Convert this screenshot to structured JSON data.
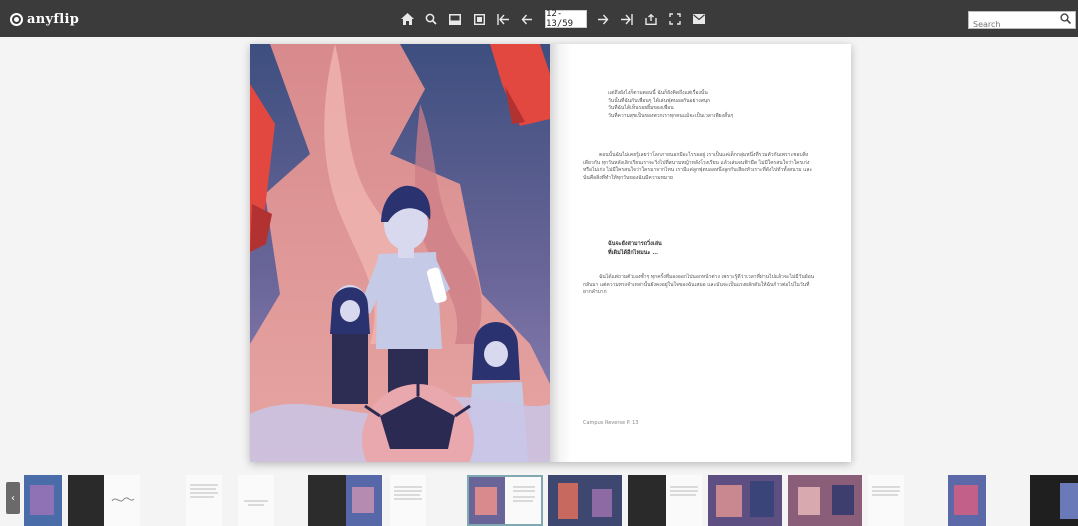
{
  "app": {
    "logo_text": "anyflip"
  },
  "toolbar": {
    "icons": [
      "home-icon",
      "zoom-icon",
      "thumbnails-icon",
      "single-page-icon",
      "first-page-icon",
      "prev-page-icon"
    ],
    "page_indicator": "12-13/59",
    "icons_after": [
      "next-page-icon",
      "last-page-icon",
      "share-icon",
      "fullscreen-icon",
      "email-icon"
    ]
  },
  "search": {
    "placeholder": "Search"
  },
  "page_right": {
    "block1": [
      "แต่ถึงยังไงก็ตามตอนนี้ ฉันก็ยังคิดถึงแต่เรื่องนั้น",
      "วันนั้นที่ฉันกับเพื่อนๆ ได้เล่นฟุตบอลกันอย่างสนุก",
      "วันที่ฉันได้เห็นรอยยิ้มของเพื่อน",
      "วันที่ความสุขเป็นของพวกเราทุกคนแม้จะเป็นเวลาเพียงสั้นๆ"
    ],
    "block2": "ตอนนั้นฉันไม่เคยรู้เลยว่าโลกภายนอกมีอะไรรออยู่ เราเป็นแค่เด็กกลุ่มหนึ่งที่รวมตัวกันเพราะชอบสิ่งเดียวกัน ทุกวันหลังเลิกเรียนเราจะวิ่งไปที่สนามหญ้าหลังโรงเรียน แล้วเล่นจนฟ้ามืด ไม่มีใครสนใจว่าใครเก่งหรือไม่เก่ง ไม่มีใครสนใจว่าใครมาจากไหน เรามีแค่ลูกฟุตบอลหนึ่งลูกกับเสียงหัวเราะที่ดังไปทั่วทั้งสนาม และนั่นคือสิ่งที่ทำให้ทุกวันของฉันมีความหมาย",
    "heading": [
      "ฉันจะยังสามารถวิ่งเล่น",
      "ที่เดิมได้อีกไหมนะ ..."
    ],
    "block3": "ฉันได้แต่ถามตัวเองซ้ำๆ ทุกครั้งที่มองออกไปนอกหน้าต่าง เพราะรู้ดีว่าเวลาที่ผ่านไปแล้วจะไม่มีวันย้อนกลับมา แต่ความทรงจำเหล่านั้นยังคงอยู่ในใจของฉันเสมอ และมันจะเป็นแรงผลักดันให้ฉันก้าวต่อไปในวันที่ยากลำบาก",
    "footer": "Campus Reverse P. 13"
  },
  "thumbnails": {
    "prev_label": "‹"
  },
  "colors": {
    "toolbar_bg": "#3b3b3b",
    "page_bg": "#f4f4f4"
  }
}
